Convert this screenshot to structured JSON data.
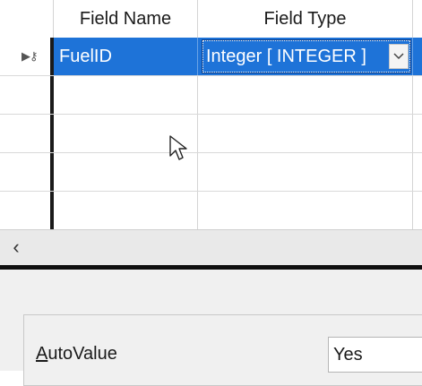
{
  "table": {
    "columns": [
      {
        "label": "Field Name"
      },
      {
        "label": "Field Type"
      }
    ],
    "rows": [
      {
        "field_name": "FuelID",
        "field_type": "Integer [ INTEGER ]",
        "primary_key": true,
        "selected": true
      },
      {
        "field_name": "",
        "field_type": ""
      },
      {
        "field_name": "",
        "field_type": ""
      },
      {
        "field_name": "",
        "field_type": ""
      },
      {
        "field_name": "",
        "field_type": ""
      }
    ]
  },
  "scrollbar": {
    "left_arrow_glyph": "‹"
  },
  "properties": {
    "autovalue": {
      "label_access_key": "A",
      "label_rest": "utoValue",
      "value": "Yes"
    }
  },
  "icons": {
    "primary_key_marker": "primary-key-icon",
    "dropdown": "chevron-down-icon",
    "scroll_left": "chevron-left-icon",
    "cursor": "mouse-pointer-icon"
  },
  "colors": {
    "selection": "#1e73d8",
    "splitter": "#0f0f0f",
    "panel_bg": "#f0f0f0"
  }
}
